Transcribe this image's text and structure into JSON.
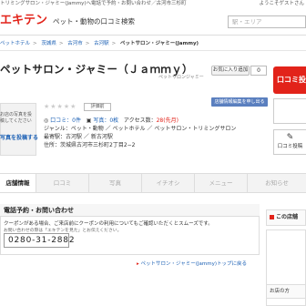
{
  "topbar": {
    "left_text": "トリミングサロン・ジャミー(Jammy)へ電話で予約・お問い合わせ／古河市三杉町",
    "right_text": "ようこそゲストさん"
  },
  "header": {
    "logo": "エキテン",
    "site_name": "ペット・動物の口コミ検索",
    "search_placeholder": "駅・エリア"
  },
  "breadcrumbs": [
    "ペットホテル",
    "茨城県",
    "古河市",
    "古河駅",
    "ペットサロン・ジャミー(Jammy)"
  ],
  "shop": {
    "title": "ペットサロン・ジャミー（Ｊａｍｍｙ）",
    "kana": "ペットサロンジャミー",
    "bookmark_label": "お気に入り追加",
    "bookmark_count": "0",
    "edit_label": "店舗情報編集を申し出る",
    "write_label": "口コミ投稿",
    "post_review_label": "口コミ投稿",
    "photo_note": "お店の写真を投稿してください",
    "photo_link": "写真を投稿する",
    "stars": "★★★★★",
    "rating_label": "評価前",
    "info": {
      "reviews": "口コミ：0件",
      "photos": "写真：0枚",
      "access_label": "アクセス数：",
      "access_value": "28(先月)",
      "genre_label": "ジャンル：",
      "genre_value": "ペット・動物 ／ ペットホテル ／ ペットサロン・トリミングサロン",
      "station_label": "最寄駅：",
      "station_value": "古河駅 ／ 新古河駅",
      "address_label": "住所：",
      "address_value": "茨城県古河市三杉町2丁目2−2"
    }
  },
  "tabs": [
    "店舗情報",
    "口コミ",
    "写真",
    "イチオシ",
    "メニュー",
    "お知らせ"
  ],
  "reservation": {
    "title": "電話予約・お問い合わせ",
    "text1": "クーポンがある場合、ご来店前にクーポンの利用についてもご確認いただくとスムーズです。",
    "text2": "お問い合わせの際は「エキテンを見た」とお伝えください。",
    "phone": "0280-31-2882"
  },
  "back_link": "ペットサロン・ジャミー(Jammy)トップに戻る",
  "side": {
    "box1": "この店舗",
    "box3": "お店の方"
  }
}
